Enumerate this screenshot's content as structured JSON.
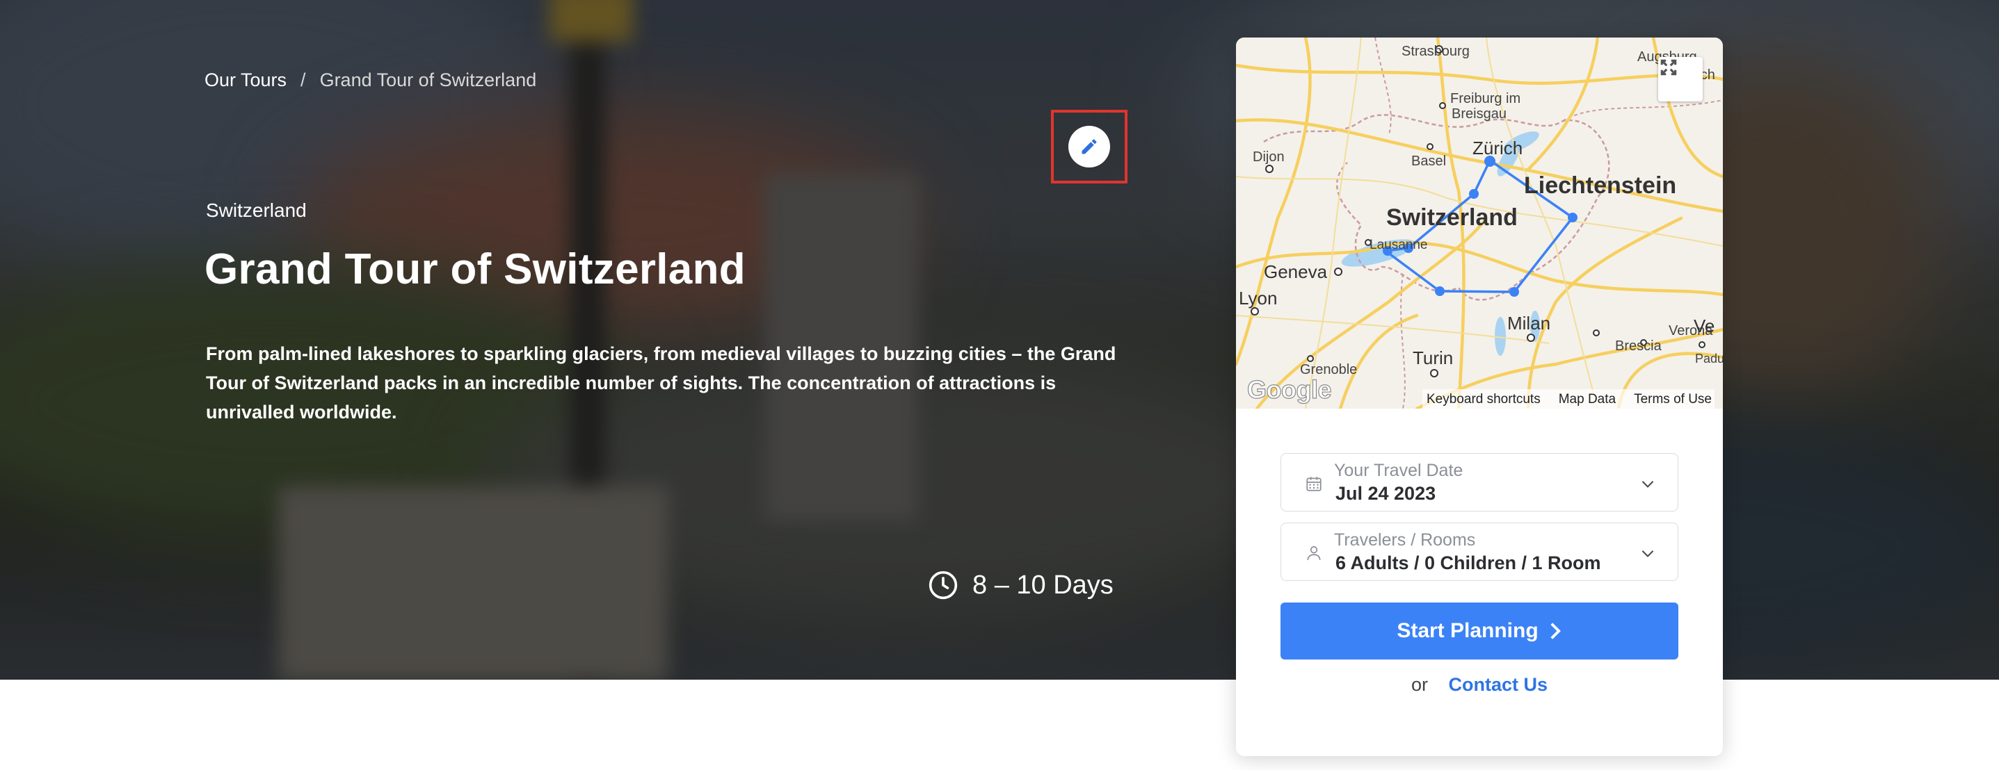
{
  "breadcrumb": {
    "root": "Our Tours",
    "separator": "/",
    "current": "Grand Tour of Switzerland"
  },
  "hero": {
    "region": "Switzerland",
    "title": "Grand Tour of Switzerland",
    "description": "From palm-lined lakeshores to sparkling glaciers, from medieval villages to buzzing cities – the Grand Tour of Switzerland packs in an incredible number of sights. The concentration of attractions is unrivalled worldwide.",
    "duration": "8 – 10 Days",
    "edit_icon": "pencil-icon",
    "duration_icon": "clock-icon"
  },
  "map": {
    "labels": {
      "strasbourg": "Strasbourg",
      "augsburg": "Augsburg",
      "munich": "Mu­ch",
      "freiburg_1": "Freiburg im",
      "freiburg_2": "Breisgau",
      "zurich": "Zürich",
      "basel": "Basel",
      "dijon": "Dijon",
      "liechtenstein": "Liechtenstein",
      "switzerland": "Switzerland",
      "lausanne": "Lausanne",
      "geneva": "Geneva",
      "lyon": "Lyon",
      "grenoble": "Grenoble",
      "milan": "Milan",
      "brescia": "Brescia",
      "verona": "Verona",
      "ve": "Ve",
      "padua": "Padua",
      "turin": "Turin"
    },
    "google": "Google",
    "footer": {
      "shortcuts": "Keyboard shortcuts",
      "data": "Map Data",
      "terms": "Terms of Use"
    },
    "fullscreen_icon": "fullscreen-icon",
    "route_color": "#3b82f6"
  },
  "booking": {
    "date": {
      "label": "Your Travel Date",
      "value": "Jul 24 2023",
      "icon": "calendar-icon"
    },
    "travelers": {
      "label": "Travelers / Rooms",
      "value": "6 Adults / 0 Children / 1 Room",
      "icon": "person-icon"
    },
    "start_label": "Start Planning",
    "or": "or",
    "contact": "Contact Us",
    "accent_color": "#3b82f6"
  }
}
